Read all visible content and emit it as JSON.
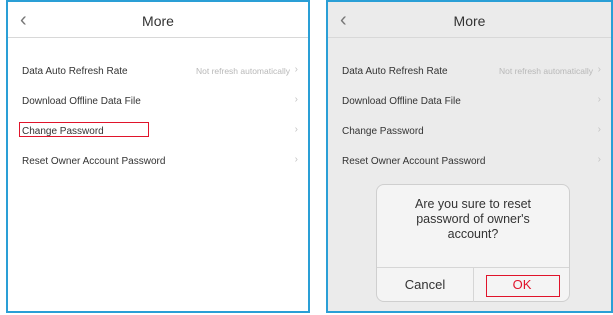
{
  "colors": {
    "frame_border": "#2a9fd6",
    "highlight": "#e0142b",
    "dim_background": "#ebebeb"
  },
  "left_screen": {
    "back_icon": "‹",
    "title": "More",
    "menu": [
      {
        "label": "Data Auto Refresh Rate",
        "value": "Not refresh automatically",
        "chevron": "›"
      },
      {
        "label": "Download Offline Data File",
        "value": "",
        "chevron": "›"
      },
      {
        "label": "Change Password",
        "value": "",
        "chevron": "›"
      },
      {
        "label": "Reset Owner Account Password",
        "value": "",
        "chevron": "›"
      }
    ]
  },
  "right_screen": {
    "back_icon": "‹",
    "title": "More",
    "menu": [
      {
        "label": "Data Auto Refresh Rate",
        "value": "Not refresh automatically",
        "chevron": "›"
      },
      {
        "label": "Download Offline Data File",
        "value": "",
        "chevron": "›"
      },
      {
        "label": "Change Password",
        "value": "",
        "chevron": "›"
      },
      {
        "label": "Reset Owner Account Password",
        "value": "",
        "chevron": "›"
      }
    ],
    "dialog": {
      "message": "Are you sure to reset\npassword of owner's\naccount?",
      "cancel_label": "Cancel",
      "ok_label": "OK"
    }
  }
}
